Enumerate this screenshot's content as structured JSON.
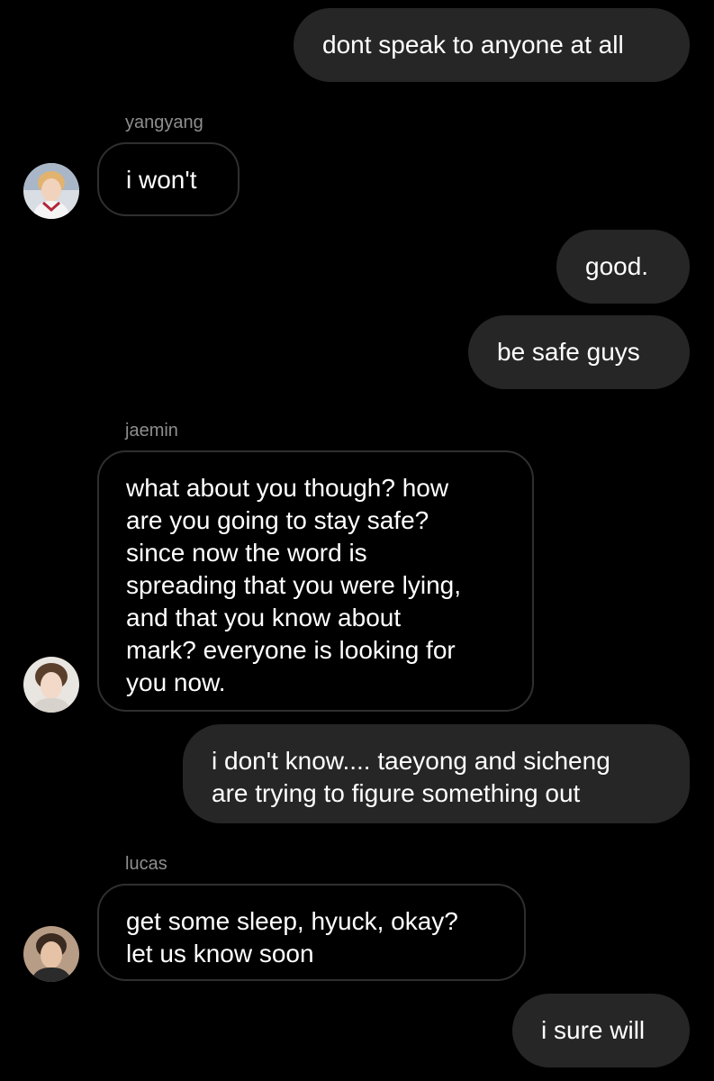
{
  "thread": {
    "messages": [
      {
        "dir": "out",
        "text": "dont speak to anyone at all"
      },
      {
        "dir": "in",
        "sender": "yangyang",
        "text": "i won't",
        "avatar_icon": "user-avatar-icon"
      },
      {
        "dir": "out",
        "text": "good."
      },
      {
        "dir": "out",
        "text": "be safe guys"
      },
      {
        "dir": "in",
        "sender": "jaemin",
        "text": "what about you though? how\nare you going to stay safe?\nsince now the word is\nspreading that you were lying,\nand that you know about\nmark? everyone is looking for\nyou now.",
        "avatar_icon": "user-avatar-icon"
      },
      {
        "dir": "out",
        "text": "i don't know.... taeyong and sicheng\nare trying to figure something out"
      },
      {
        "dir": "in",
        "sender": "lucas",
        "text": "get some sleep, hyuck, okay?\nlet us know soon",
        "avatar_icon": "user-avatar-icon"
      },
      {
        "dir": "out",
        "text": "i sure will"
      }
    ]
  },
  "colors": {
    "background": "#000000",
    "outgoing_bubble": "#262626",
    "incoming_border": "#2f2f2f",
    "sender_name": "#8e8e8e",
    "text": "#ffffff"
  }
}
